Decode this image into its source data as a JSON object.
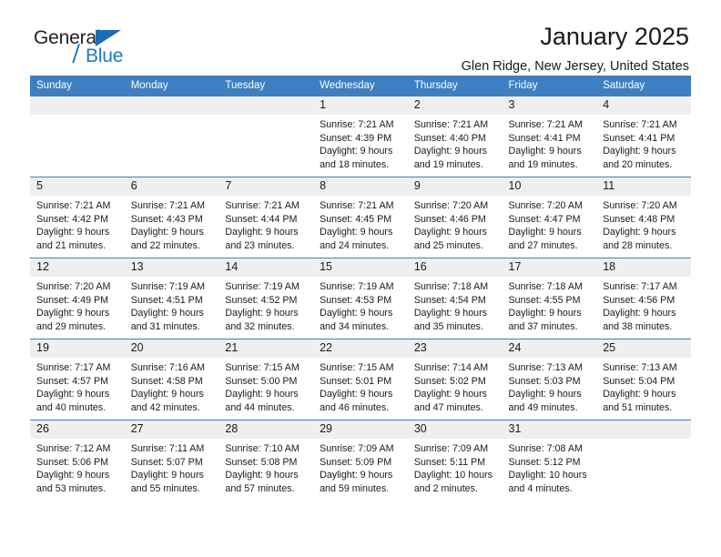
{
  "brand": {
    "name_part1": "General",
    "name_part2": "Blue",
    "logo_icon": "triangle-logo-icon",
    "accent_color": "#2079c6"
  },
  "header": {
    "title": "January 2025",
    "location": "Glen Ridge, New Jersey, United States"
  },
  "calendar": {
    "header_bg": "#3e7fc1",
    "daynum_bg": "#efefef",
    "weekday_headers": [
      "Sunday",
      "Monday",
      "Tuesday",
      "Wednesday",
      "Thursday",
      "Friday",
      "Saturday"
    ],
    "labels": {
      "sunrise": "Sunrise:",
      "sunset": "Sunset:",
      "daylight": "Daylight:"
    },
    "weeks": [
      [
        {
          "day": "",
          "sunrise": "",
          "sunset": "",
          "daylight_line1": "",
          "daylight_line2": ""
        },
        {
          "day": "",
          "sunrise": "",
          "sunset": "",
          "daylight_line1": "",
          "daylight_line2": ""
        },
        {
          "day": "",
          "sunrise": "",
          "sunset": "",
          "daylight_line1": "",
          "daylight_line2": ""
        },
        {
          "day": "1",
          "sunrise": "Sunrise: 7:21 AM",
          "sunset": "Sunset: 4:39 PM",
          "daylight_line1": "Daylight: 9 hours",
          "daylight_line2": "and 18 minutes."
        },
        {
          "day": "2",
          "sunrise": "Sunrise: 7:21 AM",
          "sunset": "Sunset: 4:40 PM",
          "daylight_line1": "Daylight: 9 hours",
          "daylight_line2": "and 19 minutes."
        },
        {
          "day": "3",
          "sunrise": "Sunrise: 7:21 AM",
          "sunset": "Sunset: 4:41 PM",
          "daylight_line1": "Daylight: 9 hours",
          "daylight_line2": "and 19 minutes."
        },
        {
          "day": "4",
          "sunrise": "Sunrise: 7:21 AM",
          "sunset": "Sunset: 4:41 PM",
          "daylight_line1": "Daylight: 9 hours",
          "daylight_line2": "and 20 minutes."
        }
      ],
      [
        {
          "day": "5",
          "sunrise": "Sunrise: 7:21 AM",
          "sunset": "Sunset: 4:42 PM",
          "daylight_line1": "Daylight: 9 hours",
          "daylight_line2": "and 21 minutes."
        },
        {
          "day": "6",
          "sunrise": "Sunrise: 7:21 AM",
          "sunset": "Sunset: 4:43 PM",
          "daylight_line1": "Daylight: 9 hours",
          "daylight_line2": "and 22 minutes."
        },
        {
          "day": "7",
          "sunrise": "Sunrise: 7:21 AM",
          "sunset": "Sunset: 4:44 PM",
          "daylight_line1": "Daylight: 9 hours",
          "daylight_line2": "and 23 minutes."
        },
        {
          "day": "8",
          "sunrise": "Sunrise: 7:21 AM",
          "sunset": "Sunset: 4:45 PM",
          "daylight_line1": "Daylight: 9 hours",
          "daylight_line2": "and 24 minutes."
        },
        {
          "day": "9",
          "sunrise": "Sunrise: 7:20 AM",
          "sunset": "Sunset: 4:46 PM",
          "daylight_line1": "Daylight: 9 hours",
          "daylight_line2": "and 25 minutes."
        },
        {
          "day": "10",
          "sunrise": "Sunrise: 7:20 AM",
          "sunset": "Sunset: 4:47 PM",
          "daylight_line1": "Daylight: 9 hours",
          "daylight_line2": "and 27 minutes."
        },
        {
          "day": "11",
          "sunrise": "Sunrise: 7:20 AM",
          "sunset": "Sunset: 4:48 PM",
          "daylight_line1": "Daylight: 9 hours",
          "daylight_line2": "and 28 minutes."
        }
      ],
      [
        {
          "day": "12",
          "sunrise": "Sunrise: 7:20 AM",
          "sunset": "Sunset: 4:49 PM",
          "daylight_line1": "Daylight: 9 hours",
          "daylight_line2": "and 29 minutes."
        },
        {
          "day": "13",
          "sunrise": "Sunrise: 7:19 AM",
          "sunset": "Sunset: 4:51 PM",
          "daylight_line1": "Daylight: 9 hours",
          "daylight_line2": "and 31 minutes."
        },
        {
          "day": "14",
          "sunrise": "Sunrise: 7:19 AM",
          "sunset": "Sunset: 4:52 PM",
          "daylight_line1": "Daylight: 9 hours",
          "daylight_line2": "and 32 minutes."
        },
        {
          "day": "15",
          "sunrise": "Sunrise: 7:19 AM",
          "sunset": "Sunset: 4:53 PM",
          "daylight_line1": "Daylight: 9 hours",
          "daylight_line2": "and 34 minutes."
        },
        {
          "day": "16",
          "sunrise": "Sunrise: 7:18 AM",
          "sunset": "Sunset: 4:54 PM",
          "daylight_line1": "Daylight: 9 hours",
          "daylight_line2": "and 35 minutes."
        },
        {
          "day": "17",
          "sunrise": "Sunrise: 7:18 AM",
          "sunset": "Sunset: 4:55 PM",
          "daylight_line1": "Daylight: 9 hours",
          "daylight_line2": "and 37 minutes."
        },
        {
          "day": "18",
          "sunrise": "Sunrise: 7:17 AM",
          "sunset": "Sunset: 4:56 PM",
          "daylight_line1": "Daylight: 9 hours",
          "daylight_line2": "and 38 minutes."
        }
      ],
      [
        {
          "day": "19",
          "sunrise": "Sunrise: 7:17 AM",
          "sunset": "Sunset: 4:57 PM",
          "daylight_line1": "Daylight: 9 hours",
          "daylight_line2": "and 40 minutes."
        },
        {
          "day": "20",
          "sunrise": "Sunrise: 7:16 AM",
          "sunset": "Sunset: 4:58 PM",
          "daylight_line1": "Daylight: 9 hours",
          "daylight_line2": "and 42 minutes."
        },
        {
          "day": "21",
          "sunrise": "Sunrise: 7:15 AM",
          "sunset": "Sunset: 5:00 PM",
          "daylight_line1": "Daylight: 9 hours",
          "daylight_line2": "and 44 minutes."
        },
        {
          "day": "22",
          "sunrise": "Sunrise: 7:15 AM",
          "sunset": "Sunset: 5:01 PM",
          "daylight_line1": "Daylight: 9 hours",
          "daylight_line2": "and 46 minutes."
        },
        {
          "day": "23",
          "sunrise": "Sunrise: 7:14 AM",
          "sunset": "Sunset: 5:02 PM",
          "daylight_line1": "Daylight: 9 hours",
          "daylight_line2": "and 47 minutes."
        },
        {
          "day": "24",
          "sunrise": "Sunrise: 7:13 AM",
          "sunset": "Sunset: 5:03 PM",
          "daylight_line1": "Daylight: 9 hours",
          "daylight_line2": "and 49 minutes."
        },
        {
          "day": "25",
          "sunrise": "Sunrise: 7:13 AM",
          "sunset": "Sunset: 5:04 PM",
          "daylight_line1": "Daylight: 9 hours",
          "daylight_line2": "and 51 minutes."
        }
      ],
      [
        {
          "day": "26",
          "sunrise": "Sunrise: 7:12 AM",
          "sunset": "Sunset: 5:06 PM",
          "daylight_line1": "Daylight: 9 hours",
          "daylight_line2": "and 53 minutes."
        },
        {
          "day": "27",
          "sunrise": "Sunrise: 7:11 AM",
          "sunset": "Sunset: 5:07 PM",
          "daylight_line1": "Daylight: 9 hours",
          "daylight_line2": "and 55 minutes."
        },
        {
          "day": "28",
          "sunrise": "Sunrise: 7:10 AM",
          "sunset": "Sunset: 5:08 PM",
          "daylight_line1": "Daylight: 9 hours",
          "daylight_line2": "and 57 minutes."
        },
        {
          "day": "29",
          "sunrise": "Sunrise: 7:09 AM",
          "sunset": "Sunset: 5:09 PM",
          "daylight_line1": "Daylight: 9 hours",
          "daylight_line2": "and 59 minutes."
        },
        {
          "day": "30",
          "sunrise": "Sunrise: 7:09 AM",
          "sunset": "Sunset: 5:11 PM",
          "daylight_line1": "Daylight: 10 hours",
          "daylight_line2": "and 2 minutes."
        },
        {
          "day": "31",
          "sunrise": "Sunrise: 7:08 AM",
          "sunset": "Sunset: 5:12 PM",
          "daylight_line1": "Daylight: 10 hours",
          "daylight_line2": "and 4 minutes."
        },
        {
          "day": "",
          "sunrise": "",
          "sunset": "",
          "daylight_line1": "",
          "daylight_line2": ""
        }
      ]
    ]
  }
}
